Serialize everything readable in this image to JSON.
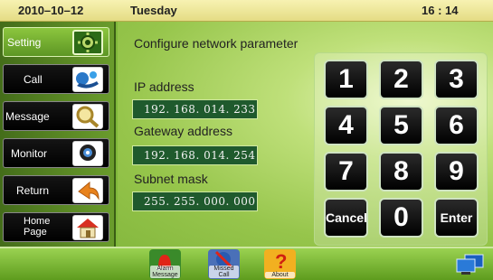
{
  "status": {
    "date": "2010–10–12",
    "day": "Tuesday",
    "time": "16 : 14"
  },
  "sidebar": {
    "items": [
      {
        "label": "Setting",
        "icon": "setting-icon",
        "active": true
      },
      {
        "label": "Call",
        "icon": "call-icon"
      },
      {
        "label": "Message",
        "icon": "message-icon"
      },
      {
        "label": "Monitor",
        "icon": "monitor-icon"
      },
      {
        "label": "Return",
        "icon": "return-icon"
      },
      {
        "label": "Home Page",
        "icon": "home-icon"
      }
    ]
  },
  "main": {
    "title": "Configure network parameter",
    "fields": [
      {
        "label": "IP address",
        "value": "192. 168. 014. 233"
      },
      {
        "label": "Gateway address",
        "value": "192. 168. 014. 254"
      },
      {
        "label": "Subnet mask",
        "value": "255. 255. 000. 000"
      }
    ]
  },
  "keypad": {
    "keys": [
      "1",
      "2",
      "3",
      "4",
      "5",
      "6",
      "7",
      "8",
      "9",
      "Cancel",
      "0",
      "Enter"
    ]
  },
  "bottom": {
    "buttons": [
      {
        "label": "Alarm Message",
        "icon": "alarm-icon"
      },
      {
        "label": "Missed Call",
        "icon": "missed-call-icon"
      },
      {
        "label": "About",
        "icon": "about-icon"
      }
    ],
    "network_icon": "network-icon"
  },
  "colors": {
    "accent": "#7fb83a",
    "field_bg": "#1f5a2d",
    "key_bg": "#000000"
  }
}
